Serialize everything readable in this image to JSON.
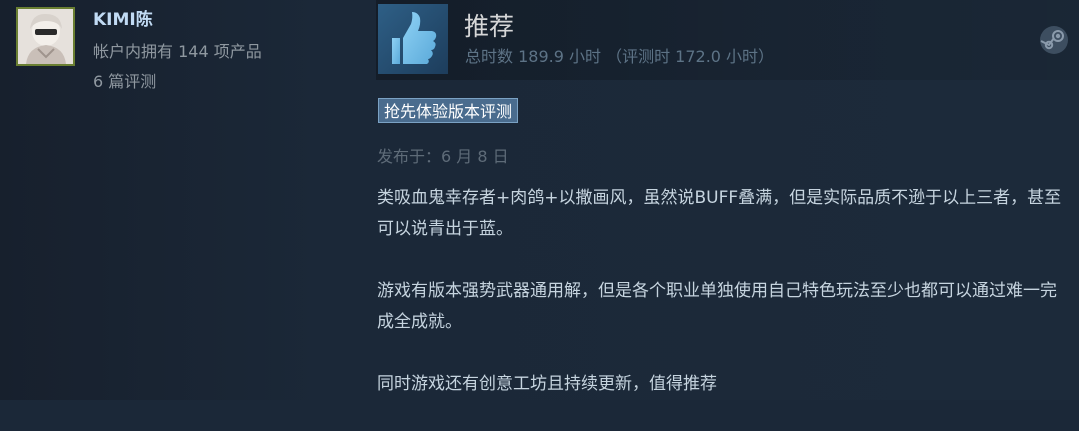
{
  "reviewer": {
    "persona_name": "KIMI陈",
    "products_owned": "帐户内拥有 144 项产品",
    "review_count": "6 篇评测"
  },
  "review": {
    "title": "推荐",
    "hours": "总时数 189.9 小时  （评测时 172.0 小时）",
    "early_access_badge": "抢先体验版本评测",
    "posted_date": "发布于：6 月 8 日",
    "paragraphs": [
      "类吸血鬼幸存者+肉鸽+以撒画风，虽然说BUFF叠满，但是实际品质不逊于以上三者，甚至可以说青出于蓝。",
      "游戏有版本强势武器通用解，但是各个职业单独使用自己特色玩法至少也都可以通过难一完成全成就。",
      "同时游戏还有创意工坊且持续更新，值得推荐"
    ],
    "icons": {
      "vote": "thumbs-up-icon",
      "platform": "steam-logo-icon"
    }
  },
  "colors": {
    "background": "#1b2838",
    "persona": "#c1dbf4",
    "text": "#c6d4df",
    "muted": "#8f98a0",
    "badge": "#4a6c8e",
    "thumb_box": "#2e5f86"
  }
}
